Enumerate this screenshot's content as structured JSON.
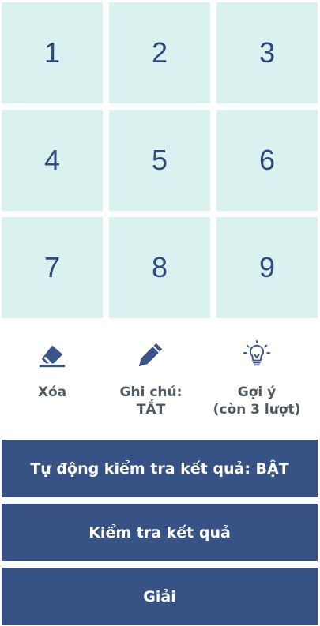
{
  "keypad": {
    "keys": [
      "1",
      "2",
      "3",
      "4",
      "5",
      "6",
      "7",
      "8",
      "9"
    ]
  },
  "tools": {
    "erase": {
      "label": "Xóa",
      "icon": "eraser-icon"
    },
    "notes": {
      "label_line1": "Ghi chú:",
      "label_line2": "TẮT",
      "icon": "pencil-icon"
    },
    "hint": {
      "label_line1": "Gợi ý",
      "label_line2": "(còn 3 lượt)",
      "icon": "lightbulb-icon"
    }
  },
  "buttons": {
    "auto_check": "Tự động kiểm tra kết quả: BẬT",
    "check": "Kiểm tra kết quả",
    "solve": "Giải"
  },
  "colors": {
    "key_bg": "#d9f1ef",
    "key_text": "#2e4a7d",
    "button_bg": "#375284",
    "icon": "#3a5589",
    "tool_label": "#4d5962"
  }
}
